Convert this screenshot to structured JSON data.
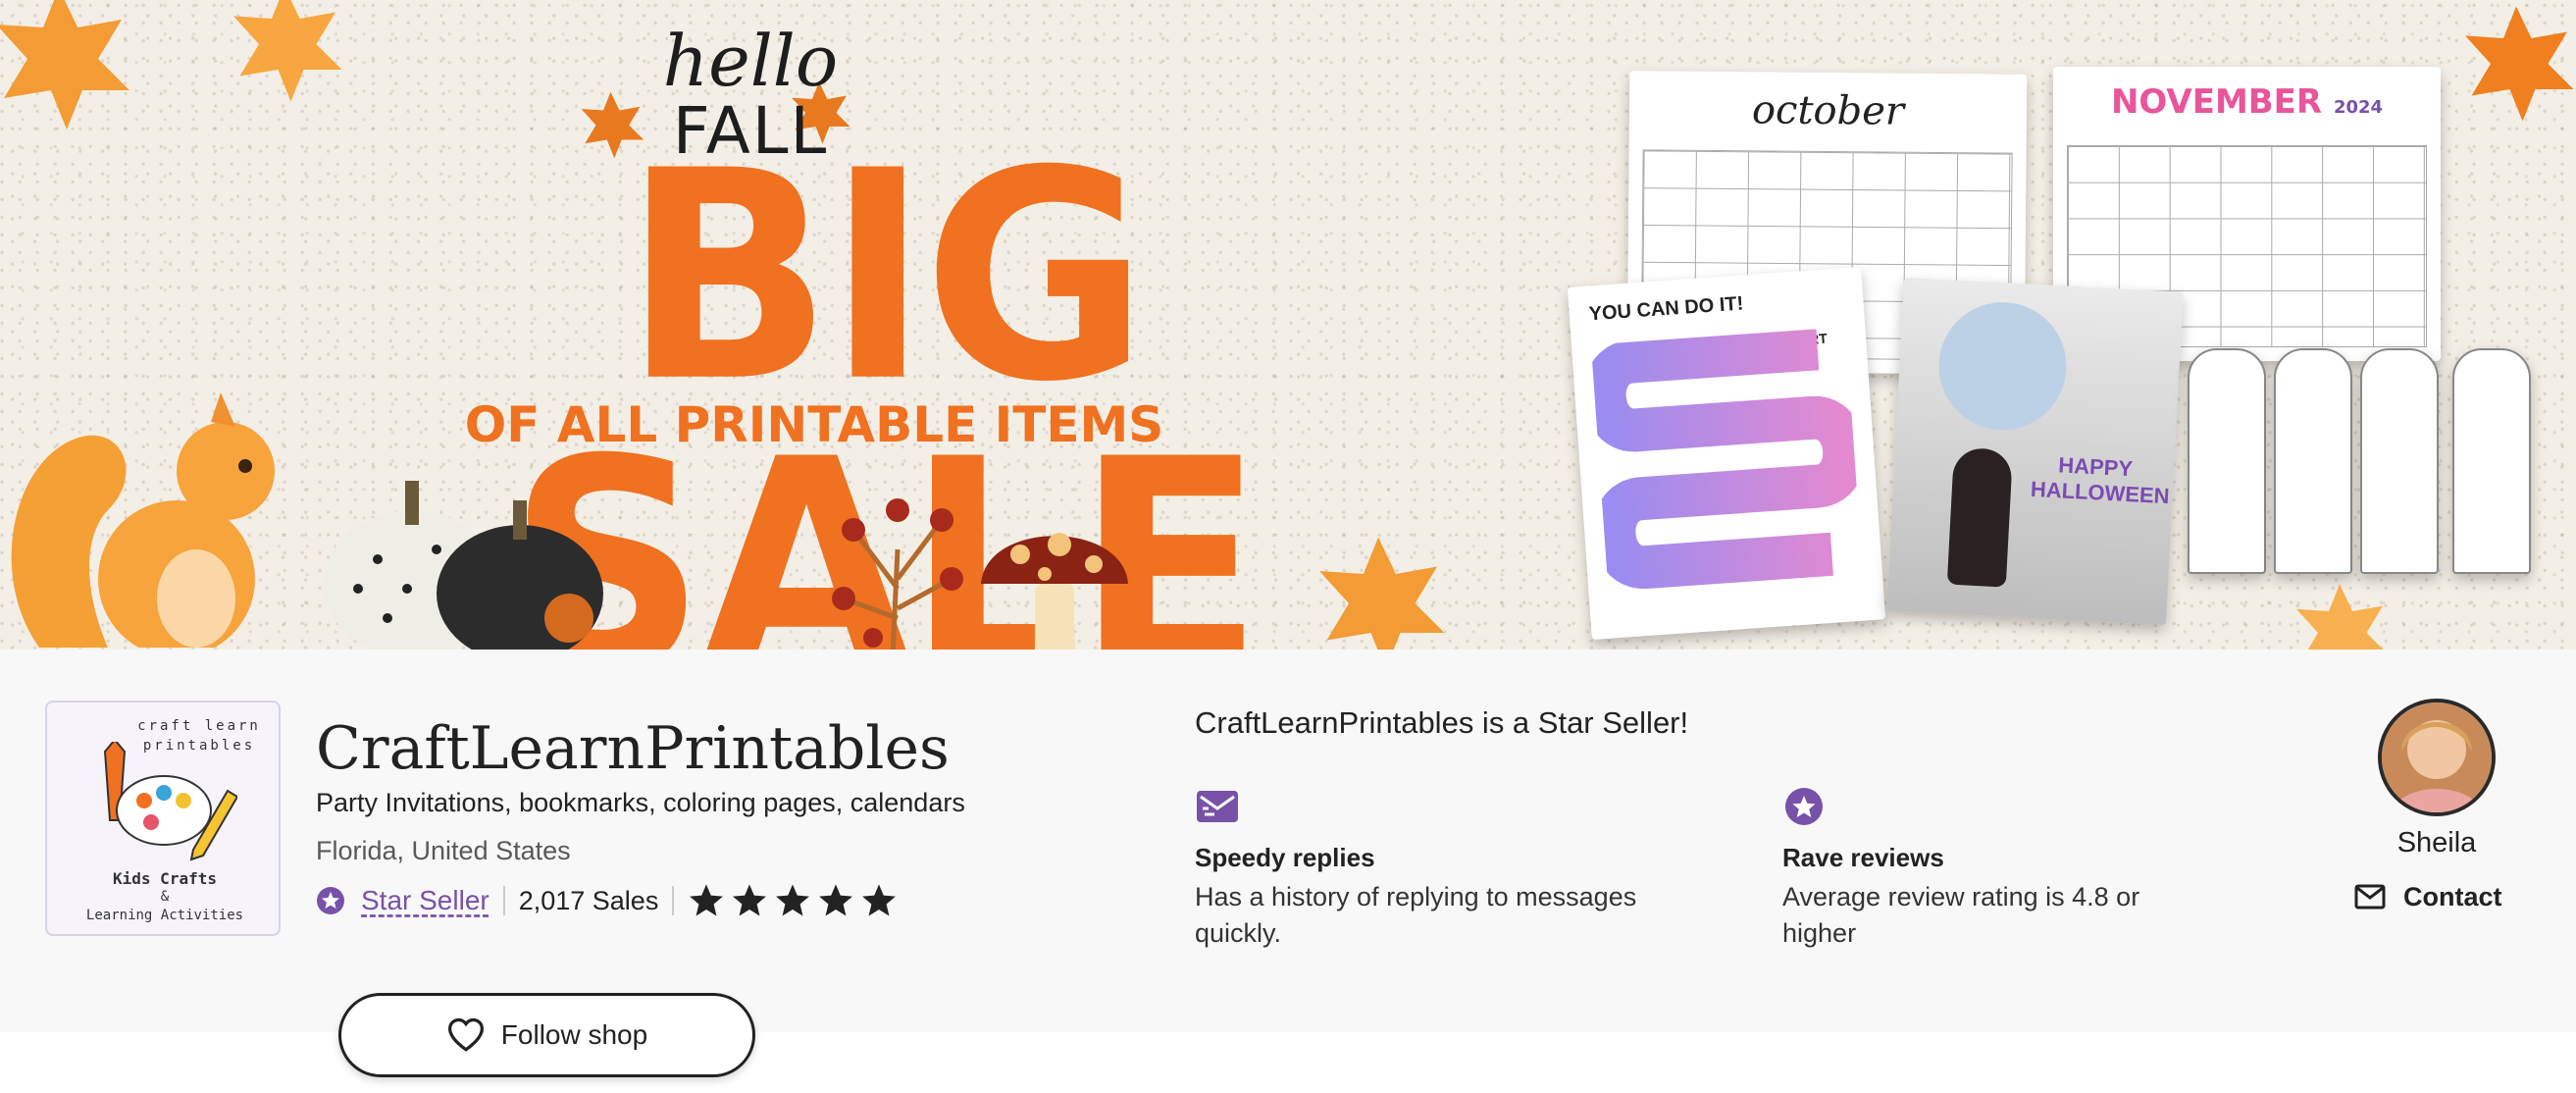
{
  "banner": {
    "hello": "hello",
    "fall": "FALL",
    "headline": "BIG SALE",
    "subheadline": "OF ALL PRINTABLE ITEMS",
    "calendar_october_title": "october",
    "calendar_november_title": "NOVEMBER",
    "calendar_november_year": "2024",
    "board_game_title": "YOU CAN DO IT!",
    "board_game_start": "START",
    "halloween_card_title": "HAPPY HALLOWEEN",
    "colors": {
      "accent": "#f07120",
      "background": "#f4efe6"
    }
  },
  "shop": {
    "logo": {
      "top_text": "craft learn printables",
      "bottom_text_1": "Kids Crafts",
      "bottom_text_2": "&",
      "bottom_text_3": "Learning Activities"
    },
    "name": "CraftLearnPrintables",
    "title": "Party Invitations, bookmarks, coloring pages, calendars",
    "location": "Florida, United States",
    "star_seller_label": "Star Seller",
    "sales": "2,017 Sales",
    "rating_stars": 5,
    "star_seller_heading": "CraftLearnPrintables is a Star Seller!",
    "features": [
      {
        "title": "Speedy replies",
        "description": "Has a history of replying to messages quickly.",
        "icon": "envelope-icon"
      },
      {
        "title": "Rave reviews",
        "description": "Average review rating is 4.8 or higher",
        "icon": "star-badge-icon"
      }
    ],
    "owner_name": "Sheila",
    "contact_label": "Contact",
    "follow_label": "Follow shop",
    "colors": {
      "star_seller": "#7851a9",
      "stars": "#222222"
    }
  }
}
